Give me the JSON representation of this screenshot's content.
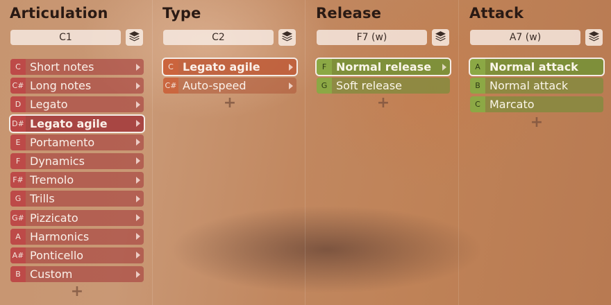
{
  "columns": [
    {
      "title": "Articulation",
      "trigger": "C1",
      "color": "#a53c3c",
      "items": [
        {
          "key": "C",
          "label": "Short notes",
          "chevron": true
        },
        {
          "key": "C#",
          "label": "Long notes",
          "chevron": true
        },
        {
          "key": "D",
          "label": "Legato",
          "chevron": true
        },
        {
          "key": "D#",
          "label": "Legato agile",
          "chevron": true,
          "selected": true
        },
        {
          "key": "E",
          "label": "Portamento",
          "chevron": true
        },
        {
          "key": "F",
          "label": "Dynamics",
          "chevron": true
        },
        {
          "key": "F#",
          "label": "Tremolo",
          "chevron": true
        },
        {
          "key": "G",
          "label": "Trills",
          "chevron": true
        },
        {
          "key": "G#",
          "label": "Pizzicato",
          "chevron": true
        },
        {
          "key": "A",
          "label": "Harmonics",
          "chevron": true
        },
        {
          "key": "A#",
          "label": "Ponticello",
          "chevron": true
        },
        {
          "key": "B",
          "label": "Custom",
          "chevron": true
        }
      ],
      "add_label": "+"
    },
    {
      "title": "Type",
      "trigger": "C2",
      "color": "#cd643c",
      "items": [
        {
          "key": "C",
          "label": "Legato agile",
          "chevron": true,
          "selected": true
        },
        {
          "key": "C#",
          "label": "Auto-speed",
          "chevron": true
        }
      ],
      "add_label": "+"
    },
    {
      "title": "Release",
      "trigger": "F7 (w)",
      "color": "#8caa46",
      "items": [
        {
          "key": "F",
          "label": "Normal release",
          "chevron": true,
          "selected": true
        },
        {
          "key": "G",
          "label": "Soft release",
          "chevron": false
        }
      ],
      "add_label": "+"
    },
    {
      "title": "Attack",
      "trigger": "A7 (w)",
      "color": "#8caa46",
      "items": [
        {
          "key": "A",
          "label": "Normal attack",
          "chevron": false,
          "selected": true
        },
        {
          "key": "B",
          "label": "Normal attack",
          "chevron": false
        },
        {
          "key": "C",
          "label": "Marcato",
          "chevron": false
        }
      ],
      "add_label": "+"
    }
  ],
  "icons": {
    "layers": "layers-icon",
    "chevron": "chevron-right-icon",
    "add": "plus-icon"
  }
}
